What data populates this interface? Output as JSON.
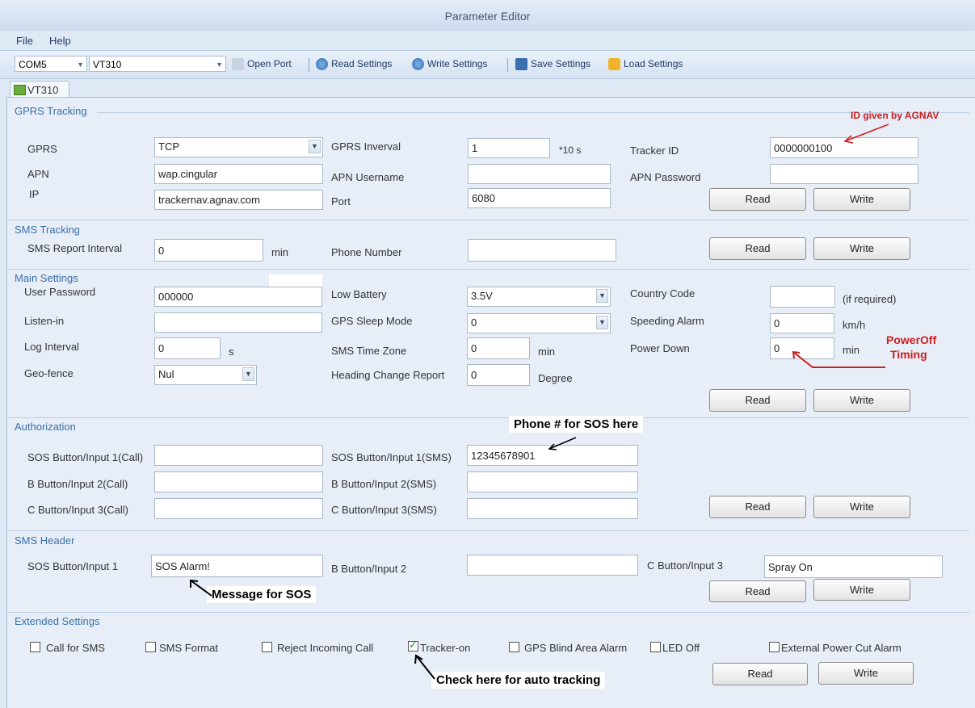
{
  "window": {
    "title": "Parameter Editor"
  },
  "menu": {
    "file": "File",
    "help": "Help"
  },
  "toolbar": {
    "port": "COM5",
    "model": "VT310",
    "open_port": "Open Port",
    "read_settings": "Read Settings",
    "write_settings": "Write Settings",
    "save_settings": "Save Settings",
    "load_settings": "Load Settings"
  },
  "tab": {
    "label": "VT310"
  },
  "buttons": {
    "read": "Read",
    "write": "Write"
  },
  "gprs": {
    "title": "GPRS Tracking",
    "gprs_label": "GPRS",
    "gprs_value": "TCP",
    "interval_label": "GPRS Inverval",
    "interval_value": "1",
    "interval_unit": "*10 s",
    "tracker_id_label": "Tracker ID",
    "tracker_id_value": "0000000100",
    "apn_label": "APN",
    "apn_value": "wap.cingular",
    "apn_user_label": "APN Username",
    "apn_user_value": "",
    "apn_pass_label": "APN Password",
    "apn_pass_value": "",
    "ip_label": "IP",
    "ip_value": "trackernav.agnav.com",
    "port_label": "Port",
    "port_value": "6080"
  },
  "sms_tracking": {
    "title": "SMS Tracking",
    "interval_label": "SMS Report Interval",
    "interval_value": "0",
    "interval_unit": "min",
    "phone_label": "Phone Number",
    "phone_value": ""
  },
  "main": {
    "title": "Main Settings",
    "user_password_label": "User Password",
    "user_password_value": "000000",
    "low_battery_label": "Low Battery",
    "low_battery_value": "3.5V",
    "country_code_label": "Country Code",
    "country_code_value": "",
    "country_code_note": "(if required)",
    "listen_in_label": "Listen-in",
    "listen_in_value": "",
    "gps_sleep_label": "GPS Sleep Mode",
    "gps_sleep_value": "0",
    "speeding_label": "Speeding Alarm",
    "speeding_value": "0",
    "speeding_unit": "km/h",
    "log_interval_label": "Log Interval",
    "log_interval_value": "0",
    "log_interval_unit": "s",
    "sms_tz_label": "SMS Time Zone",
    "sms_tz_value": "0",
    "sms_tz_unit": "min",
    "power_down_label": "Power Down",
    "power_down_value": "0",
    "power_down_unit": "min",
    "geofence_label": "Geo-fence",
    "geofence_value": "Nul",
    "heading_label": "Heading Change Report",
    "heading_value": "0",
    "heading_unit": "Degree"
  },
  "authorization": {
    "title": "Authorization",
    "sos_call_label": "SOS Button/Input 1(Call)",
    "sos_call_value": "",
    "sos_sms_label": "SOS Button/Input 1(SMS)",
    "sos_sms_value": "12345678901",
    "b_call_label": "B Button/Input 2(Call)",
    "b_call_value": "",
    "b_sms_label": "B Button/Input 2(SMS)",
    "b_sms_value": "",
    "c_call_label": "C Button/Input 3(Call)",
    "c_call_value": "",
    "c_sms_label": "C Button/Input 3(SMS)",
    "c_sms_value": ""
  },
  "sms_header": {
    "title": "SMS Header",
    "sos_label": "SOS Button/Input 1",
    "sos_value": "SOS Alarm!",
    "b_label": "B Button/Input 2",
    "b_value": "",
    "c_label": "C Button/Input 3",
    "c_value": "Spray On"
  },
  "extended": {
    "title": "Extended Settings",
    "call_for_sms": "Call for SMS",
    "sms_format": "SMS Format",
    "reject_call": "Reject Incoming Call",
    "tracker_on": "Tracker-on",
    "gps_blind": "GPS Blind Area Alarm",
    "led_off": "LED Off",
    "ext_power": "External Power Cut Alarm"
  },
  "annotations": {
    "id_given": "ID given by AGNAV",
    "poweroff": "PowerOff",
    "timing": "Timing",
    "phone_sos": "Phone # for SOS here",
    "message_sos": "Message for SOS",
    "check_auto": "Check here for auto tracking"
  },
  "colors": {
    "accent": "#3a6fa6",
    "annotation_red": "#cc1f1f",
    "background": "#e7eef8"
  },
  "checkboxes": {
    "tracker_on_checked": true
  }
}
